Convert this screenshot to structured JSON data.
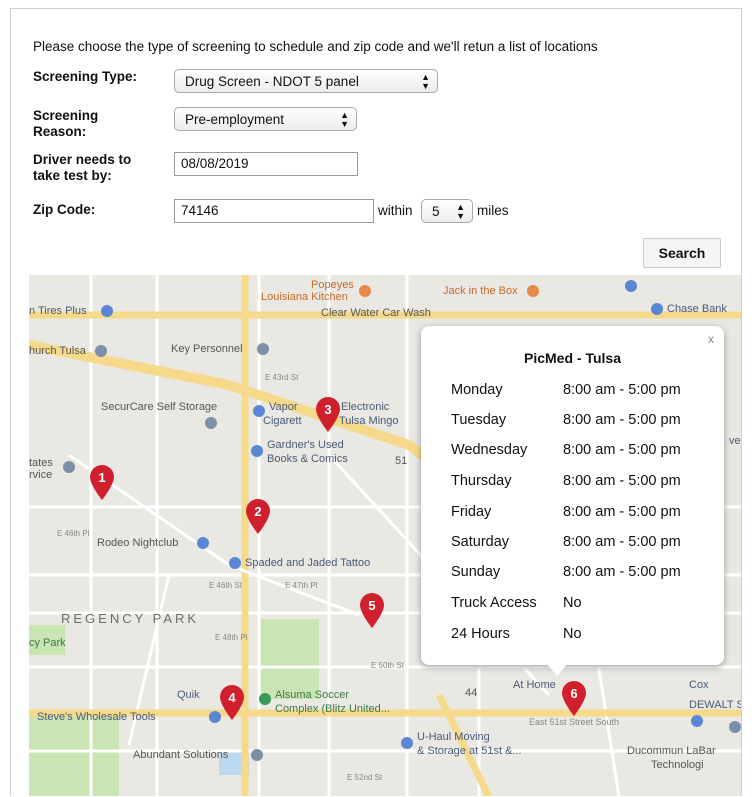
{
  "intro": "Please choose the type of screening to schedule and zip code and we'll retun a list of locations",
  "form": {
    "screening_type_label": "Screening Type:",
    "screening_type_value": "Drug Screen - NDOT 5 panel",
    "screening_reason_label_1": "Screening",
    "screening_reason_label_2": "Reason:",
    "screening_reason_value": "Pre-employment",
    "driver_label_1": "Driver needs to",
    "driver_label_2": "take test by:",
    "date_value": "08/08/2019",
    "zip_label": "Zip Code:",
    "zip_value": "74146",
    "within_label": "within",
    "miles_value": "5",
    "miles_label": "miles",
    "search_button": "Search"
  },
  "map": {
    "labels": {
      "popeyes": "Popeyes",
      "louisiana": "Louisiana Kitchen",
      "jackbox": "Jack in the Box",
      "chase": "Chase Bank",
      "tires": "n Tires Plus",
      "clearwater": "Clear Water Car Wash",
      "church": "hurch Tulsa",
      "keypersonnel": "Key Personnel",
      "vapor": "Vapor",
      "electronic": "Electronic",
      "cigarettes": "Cigarett",
      "tulsamingo": "Tulsa Mingo",
      "securcare": "SecurCare Self Storage",
      "gardners": "Gardner's Used",
      "books": "Books & Comics",
      "states": "tates",
      "rvice": "rvice",
      "rodeo": "Rodeo Nightclub",
      "spaded": "Spaded and Jaded Tattoo",
      "regency": "REGENCY PARK",
      "cypark": "cy Park",
      "quik": "Quik",
      "alsuma1": "Alsuma Soccer",
      "alsuma2": "Complex (Blitz United...",
      "steves": "Steve's Wholesale Tools",
      "athome": "At Home",
      "east51": "East 51st Street South",
      "uhaul1": "U-Haul Moving",
      "uhaul2": "& Storage at 51st &...",
      "abundant": "Abundant Solutions",
      "ducommun1": "Ducommun LaBar",
      "ducommun2": "Technologi",
      "dewalt": "DEWALT Se",
      "cox": "Cox",
      "ven": "ven",
      "s51": "51",
      "s44": "44",
      "e46th": "E 46th Pl",
      "e47th": "E 47th Pl",
      "e48th": "E 48th Pl",
      "e50th": "E 50th St",
      "e52nd": "E 52nd St",
      "e46st": "E 46th St",
      "e43rd": "E 43rd St"
    },
    "pins": [
      "1",
      "2",
      "3",
      "4",
      "5",
      "6"
    ],
    "colors": {
      "pin": "#d0202e",
      "road_major": "#f6d98a",
      "road_minor": "#ffffff",
      "park": "#c9e5b4",
      "land": "#e9e8e3"
    }
  },
  "popup": {
    "close": "x",
    "title": "PicMed - Tulsa",
    "rows": [
      {
        "day": "Monday",
        "hours": "8:00 am - 5:00 pm"
      },
      {
        "day": "Tuesday",
        "hours": "8:00 am - 5:00 pm"
      },
      {
        "day": "Wednesday",
        "hours": "8:00 am - 5:00 pm"
      },
      {
        "day": "Thursday",
        "hours": "8:00 am - 5:00 pm"
      },
      {
        "day": "Friday",
        "hours": "8:00 am - 5:00 pm"
      },
      {
        "day": "Saturday",
        "hours": "8:00 am - 5:00 pm"
      },
      {
        "day": "Sunday",
        "hours": "8:00 am - 5:00 pm"
      },
      {
        "day": "Truck Access",
        "hours": "No"
      },
      {
        "day": "24 Hours",
        "hours": "No"
      }
    ]
  }
}
